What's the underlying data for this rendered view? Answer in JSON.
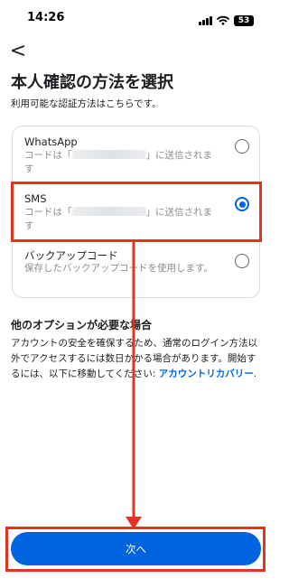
{
  "status_bar": {
    "time": "14:26",
    "battery": "53",
    "icons": [
      "signal-icon",
      "wifi-icon",
      "battery-icon"
    ]
  },
  "nav": {
    "back_glyph": "<",
    "back_icon": "chevron-left-icon"
  },
  "header": {
    "title": "本人確認の方法を選択",
    "subtitle": "利用可能な認証方法はこちらです。"
  },
  "options": [
    {
      "name": "WhatsApp",
      "desc_prefix": "コードは「",
      "desc_suffix": "」に送信されます",
      "selected": false
    },
    {
      "name": "SMS",
      "desc_prefix": "コードは「",
      "desc_suffix": "」に送信されます",
      "selected": true
    },
    {
      "name": "バックアップコード",
      "desc": "保存したバックアップコードを使用します。",
      "selected": false
    }
  ],
  "help": {
    "heading": "他のオプションが必要な場合",
    "body": "アカウントの安全を確保するため、通常のログイン方法以外でアクセスするには数日かかる場合があります。開始するには、以下に移動してください: ",
    "link": "アカウントリカバリー",
    "trailing": "."
  },
  "footer": {
    "next_label": "次へ"
  },
  "colors": {
    "accent": "#0064e0",
    "annotation": "#e53322",
    "border": "#dadde1",
    "muted_text": "#8a8d91"
  }
}
